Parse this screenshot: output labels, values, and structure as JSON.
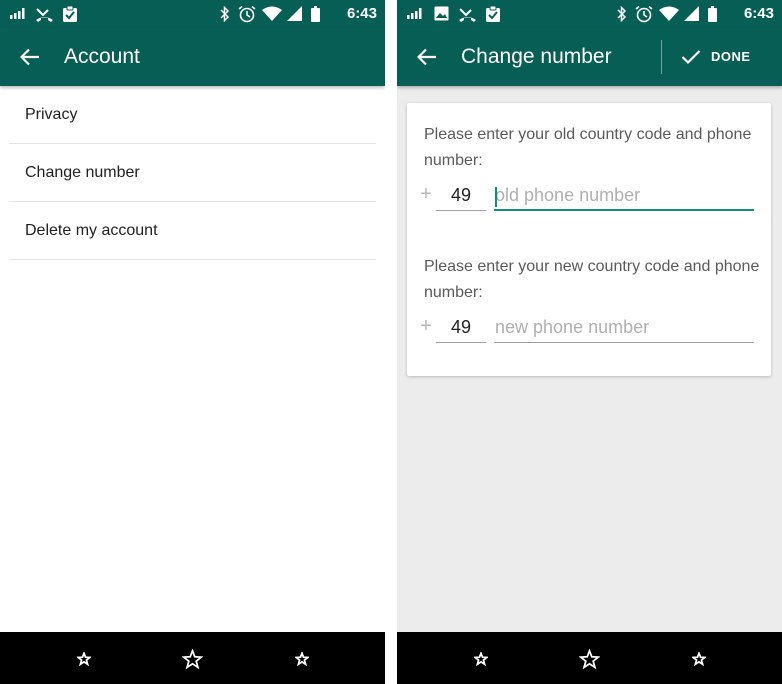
{
  "status_bar": {
    "time": "6:43",
    "icons_left_screen_left": [
      "signal-bars-icon",
      "missed-call-icon",
      "clipboard-icon"
    ],
    "icons_left_screen_right": [
      "signal-bars-icon",
      "image-icon",
      "missed-call-icon",
      "clipboard-icon"
    ],
    "icons_right": [
      "bluetooth-icon",
      "alarm-icon",
      "wifi-icon",
      "cell-signal-icon",
      "battery-icon"
    ]
  },
  "left_screen": {
    "title": "Account",
    "menu_items": [
      "Privacy",
      "Change number",
      "Delete my account"
    ]
  },
  "right_screen": {
    "title": "Change number",
    "done_label": "DONE",
    "old_prompt": "Please enter your old country code and phone number:",
    "new_prompt": "Please enter your new country code and phone number:",
    "plus": "+",
    "old_country_code": "49",
    "new_country_code": "49",
    "old_phone_placeholder": "old phone number",
    "new_phone_placeholder": "new phone number"
  },
  "nav_bar": {
    "buttons": [
      "small-star-icon",
      "star-icon",
      "small-star-icon"
    ]
  },
  "colors": {
    "primary": "#075e54",
    "accent": "#128c7e",
    "background": "#ececec"
  }
}
